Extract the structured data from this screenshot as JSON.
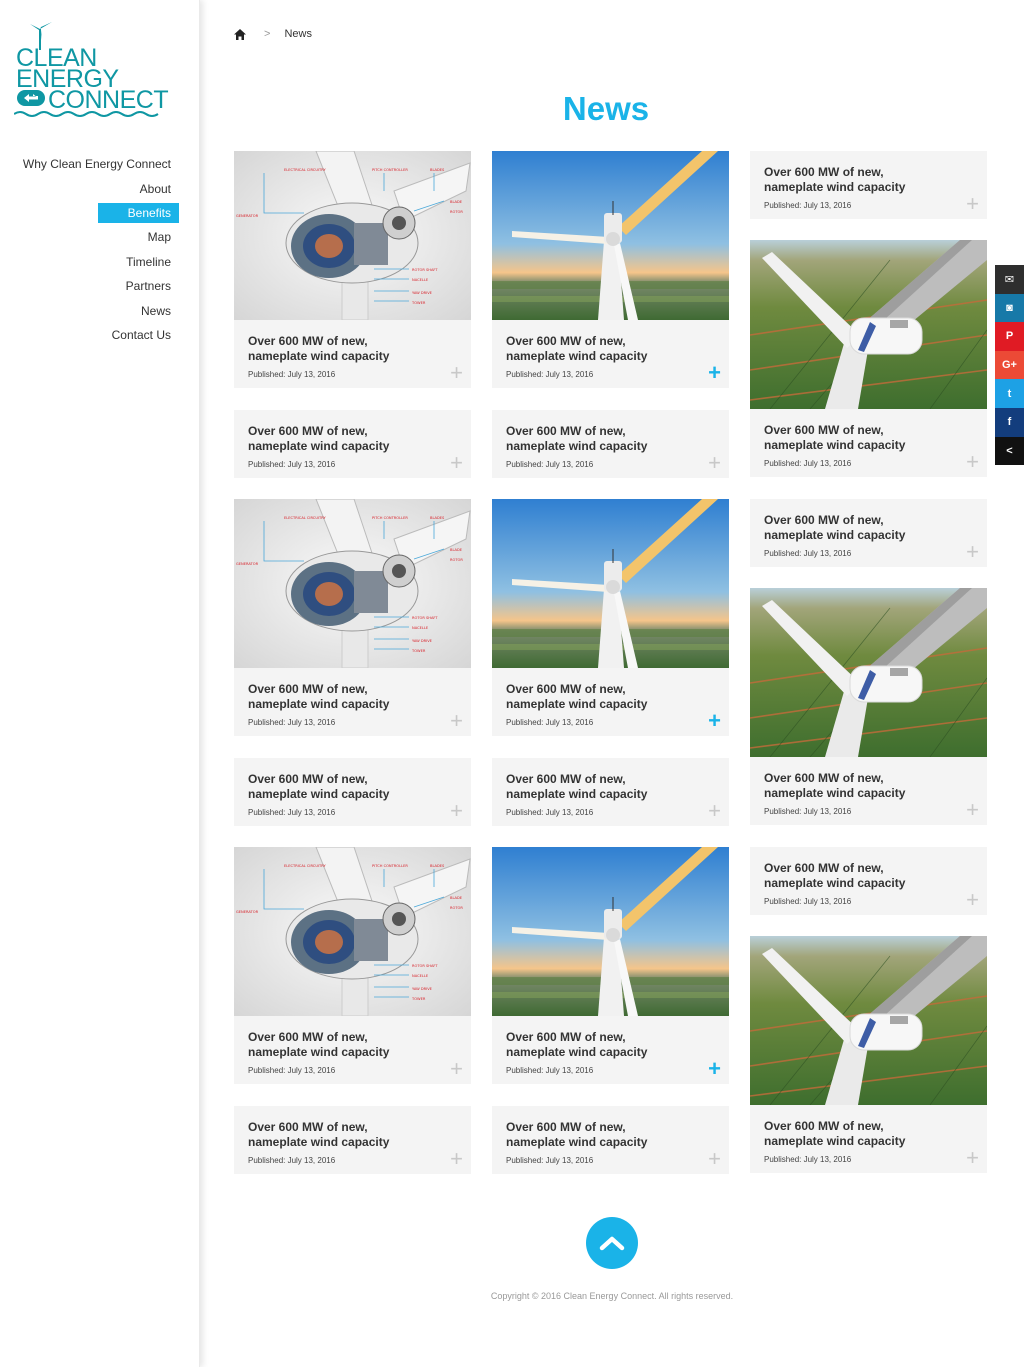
{
  "logo": {
    "line1": "CLEAN",
    "line2": "ENERGY",
    "line3": "CONNECT"
  },
  "nav": {
    "items": [
      {
        "label": "Why Clean Energy Connect",
        "active": false
      },
      {
        "label": "About",
        "active": false
      },
      {
        "label": "Benefits",
        "active": true
      },
      {
        "label": "Map",
        "active": false
      },
      {
        "label": "Timeline",
        "active": false
      },
      {
        "label": "Partners",
        "active": false
      },
      {
        "label": "News",
        "active": false
      },
      {
        "label": "Contact Us",
        "active": false
      }
    ]
  },
  "breadcrumb": {
    "home_icon": "home-icon",
    "separator": ">",
    "current": "News"
  },
  "page_title": "News",
  "cards": {
    "title": "Over  600 MW of new, nameplate wind capacity",
    "date": "Published: July 13, 2016",
    "plus": "+"
  },
  "social": [
    {
      "icon": "mail-icon",
      "color": "#2e2e2e",
      "glyph": "✉"
    },
    {
      "icon": "instagram-icon",
      "color": "#1779a8",
      "glyph": "◙"
    },
    {
      "icon": "pinterest-icon",
      "color": "#e01b24",
      "glyph": "P"
    },
    {
      "icon": "google-plus-icon",
      "color": "#ec4a36",
      "glyph": "G+"
    },
    {
      "icon": "twitter-icon",
      "color": "#1da1e5",
      "glyph": "t"
    },
    {
      "icon": "facebook-icon",
      "color": "#133d7d",
      "glyph": "f"
    },
    {
      "icon": "share-icon",
      "color": "#111111",
      "glyph": "<"
    }
  ],
  "copyright": "Copyright © 2016 Clean Energy Connect. All rights reserved.",
  "colors": {
    "accent": "#1ab3e8",
    "logo": "#0f97a3",
    "card_bg": "#f4f4f4"
  }
}
